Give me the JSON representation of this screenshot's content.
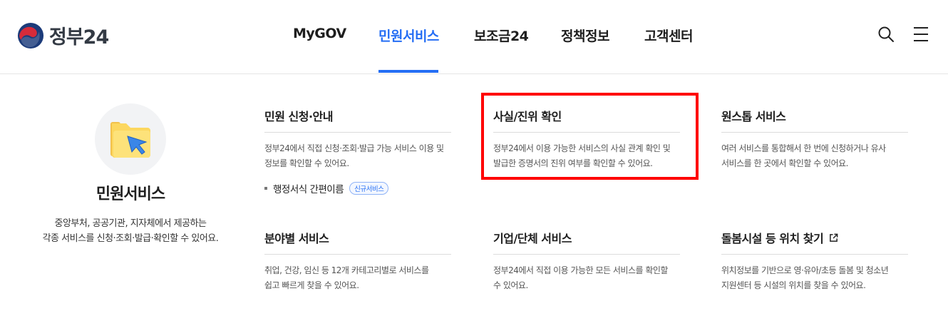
{
  "brand": {
    "name": "정부24"
  },
  "nav": {
    "items": [
      {
        "label": "MyGOV"
      },
      {
        "label": "민원서비스"
      },
      {
        "label": "보조금24"
      },
      {
        "label": "정책정보"
      },
      {
        "label": "고객센터"
      }
    ],
    "active_index": 1
  },
  "header_icons": [
    "search-icon",
    "menu-icon"
  ],
  "intro": {
    "icon": "folder-arrow-icon",
    "title": "민원서비스",
    "desc_line1": "중앙부처, 공공기관, 지자체에서 제공하는",
    "desc_line2": "각종 서비스를 신청·조회·발급·확인할 수 있어요."
  },
  "cards": [
    {
      "title": "민원 신청·안내",
      "desc_line1": "정부24에서 직접 신청·조회·발급 가능 서비스 이용 및",
      "desc_line2": "정보를 확인할 수 있어요.",
      "sub_item": {
        "label": "행정서식 간편이름",
        "badge": "신규서비스"
      }
    },
    {
      "title": "사실/진위 확인",
      "desc_line1": "정부24에서 이용 가능한 서비스의 사실 관계 확인 및",
      "desc_line2": "발급한 증명서의 진위 여부를 확인할 수 있어요."
    },
    {
      "title": "원스톱 서비스",
      "desc_line1": "여러 서비스를 통합해서 한 번에 신청하거나 유사",
      "desc_line2": "서비스를 한 곳에서 확인할 수 있어요."
    },
    {
      "title": "분야별 서비스",
      "desc_line1": "취업, 건강, 임신 등 12개 카테고리별로 서비스를",
      "desc_line2": "쉽고 빠르게 찾을 수 있어요."
    },
    {
      "title": "기업/단체 서비스",
      "desc_line1": "정부24에서 직접 이용 가능한 모든 서비스를 확인할",
      "desc_line2": "수 있어요."
    },
    {
      "title": "돌봄시설 등 위치 찾기",
      "desc_line1": "위치정보를 기반으로 영·유아/초등 돌봄 및 청소년",
      "desc_line2": "지원센터 등 시설의 위치를 찾을 수 있어요.",
      "icon": "external-link-icon"
    }
  ],
  "colors": {
    "accent": "#256ef4",
    "highlight": "#ff0000"
  }
}
